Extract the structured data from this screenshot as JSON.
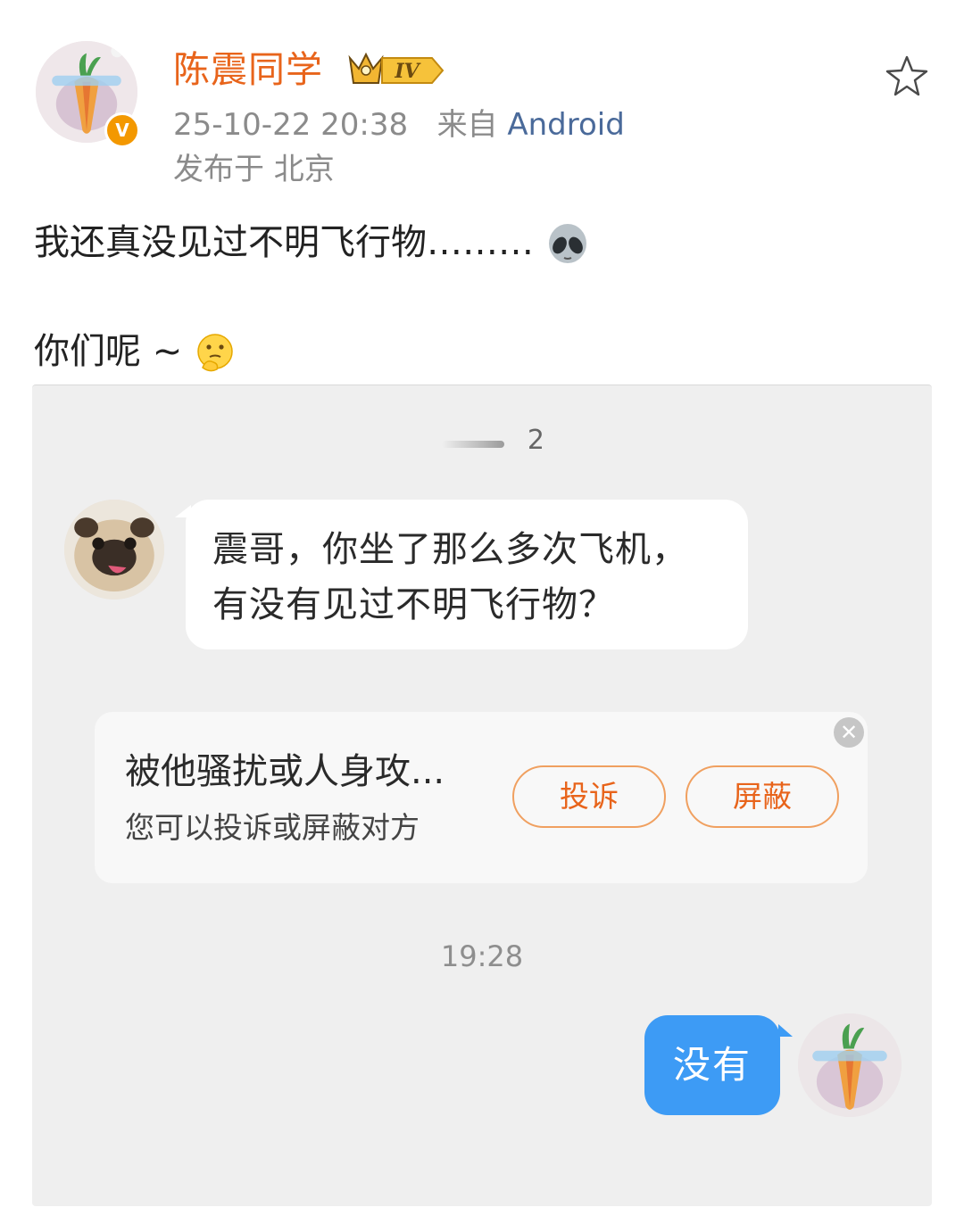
{
  "post": {
    "author": "陈震同学",
    "vip_level": "IV",
    "timestamp": "25-10-22 20:38",
    "source_prefix": "来自",
    "source": "Android",
    "location": "发布于 北京",
    "text_line_1": "我还真没见过不明飞行物………",
    "text_line_2": "你们呢 ~",
    "emoji_1": "alien-emoji",
    "emoji_2": "thinking-emoji"
  },
  "chat": {
    "title": "2",
    "friend_message": [
      "震哥，你坐了那么多次飞机，",
      "有没有见过不明飞行物？"
    ],
    "report_card": {
      "title": "被他骚扰或人身攻...",
      "subtitle": "您可以投诉或屏蔽对方",
      "report_label": "投诉",
      "block_label": "屏蔽"
    },
    "time": "19:28",
    "my_message": "没有"
  },
  "colors": {
    "author": "#e8641b",
    "source": "#4a6a9a",
    "my_bubble": "#3d9bf5",
    "pill_border": "#f0a060",
    "badge": "#f39800"
  },
  "icons": [
    "star-icon",
    "verified-icon",
    "vip-crown-icon",
    "close-icon"
  ]
}
